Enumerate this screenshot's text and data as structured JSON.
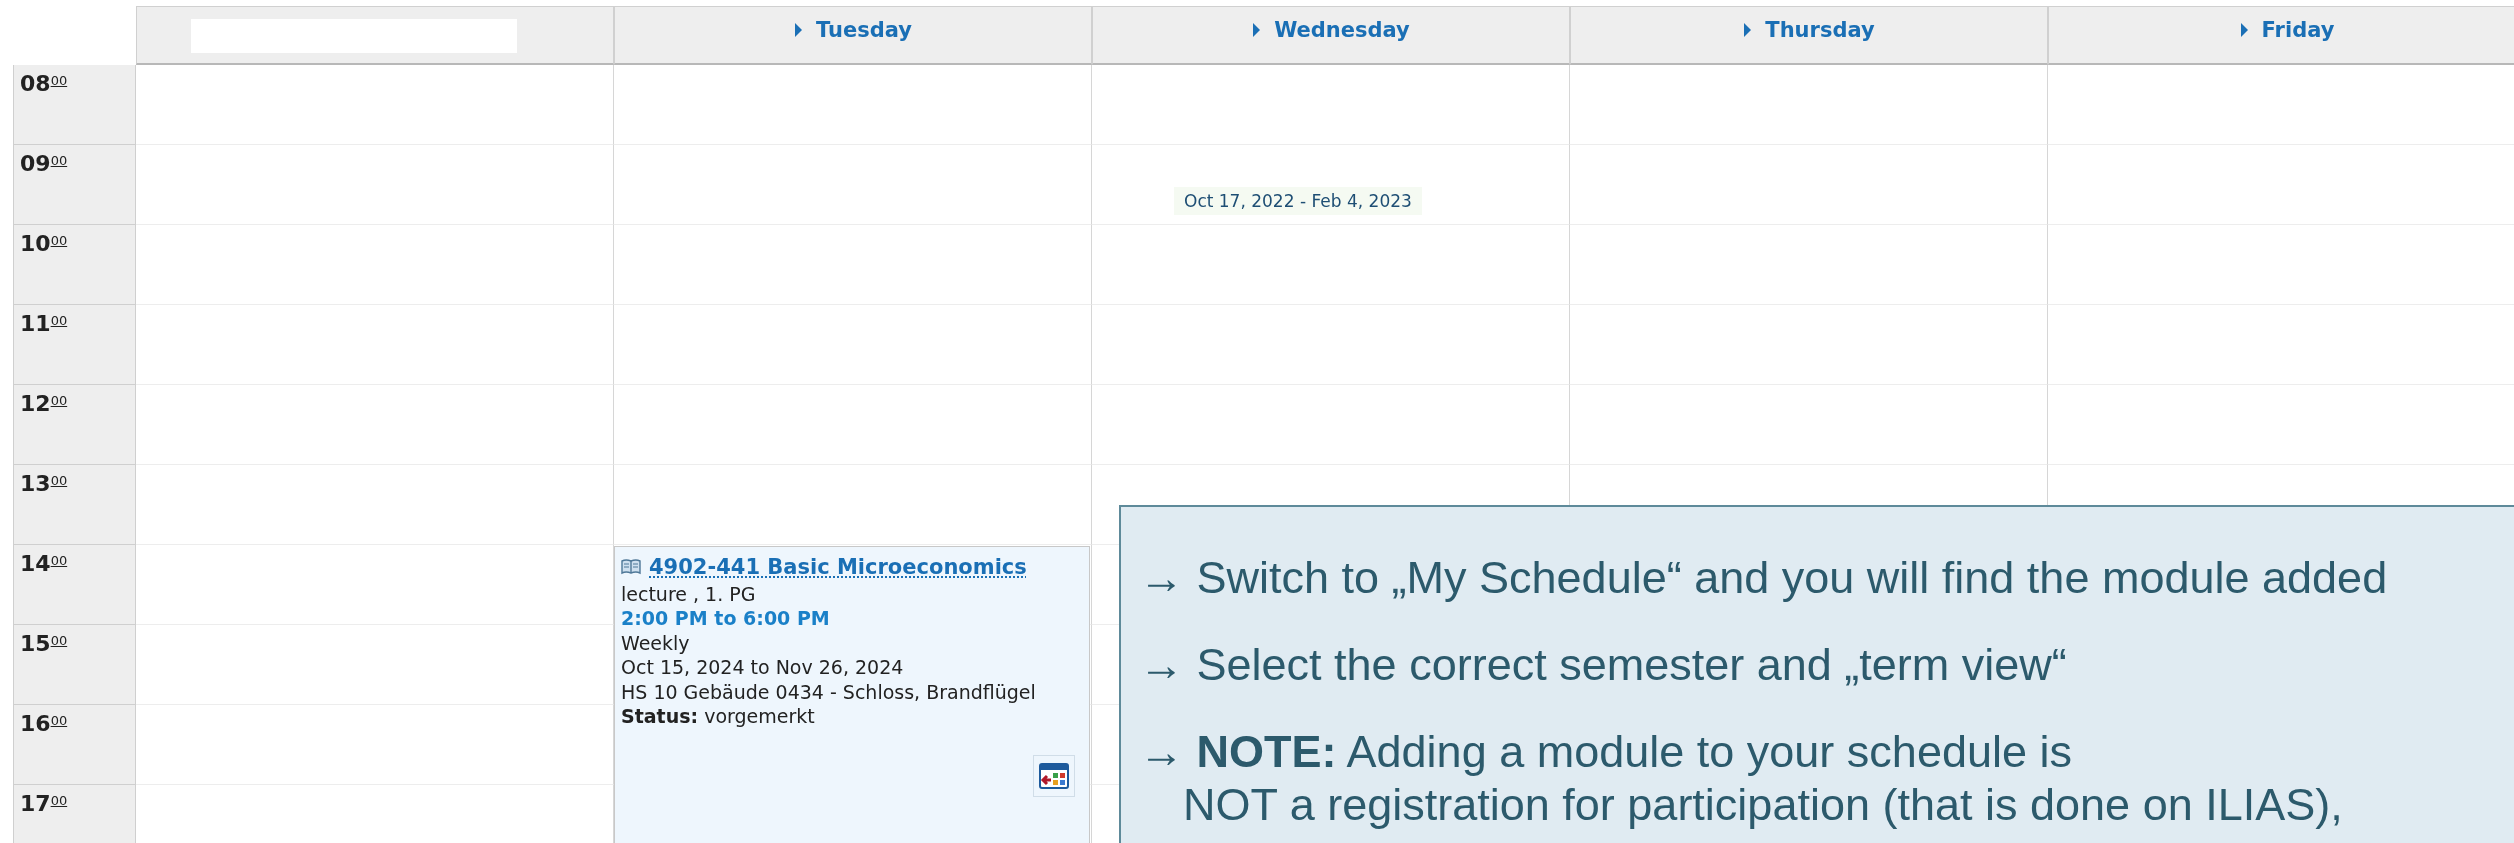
{
  "days": [
    {
      "redacted": true
    },
    {
      "redacted": false,
      "label": "Tuesday",
      "events": [
        {
          "title": "4902-441 Basic Microeconomics",
          "type": "lecture , 1. PG",
          "time": "2:00 PM to 6:00 PM",
          "recurrence": "Weekly",
          "dates": "Oct 15, 2024 to Nov 26, 2024",
          "room": "HS 10 Gebäude 0434 - Schloss, Brandflügel",
          "status": "**Status:** vorgemerkt"
        }
      ]
    },
    {
      "redacted": false,
      "label": "Wednesday",
      "tooltip": "Oct 17, 2022 - Feb 4, 2023"
    },
    {
      "redacted": false,
      "label": "Thursday"
    },
    {
      "redacted": false,
      "label": "Friday"
    }
  ],
  "hours": [
    {
      "hour": "08",
      "minutes": "00"
    },
    {
      "hour": "09",
      "minutes": "00"
    },
    {
      "hour": "10",
      "minutes": "00"
    },
    {
      "hour": "11",
      "minutes": "00"
    },
    {
      "hour": "12",
      "minutes": "00"
    },
    {
      "hour": "13",
      "minutes": "00"
    },
    {
      "hour": "14",
      "minutes": "00"
    },
    {
      "hour": "15",
      "minutes": "00"
    },
    {
      "hour": "16",
      "minutes": "00"
    },
    {
      "hour": "17",
      "minutes": "00"
    }
  ],
  "callout": {
    "items": [
      {
        "lines": [
          "→ Switch to „My Schedule“ and you will find the module added"
        ]
      },
      {
        "lines": [
          "→ Select the correct semester and „term view“"
        ]
      },
      {
        "lines": [
          "→ **NOTE:** Adding a module to your schedule is",
          "NOT a registration for participation (that is done on ILIAS),"
        ]
      }
    ]
  }
}
